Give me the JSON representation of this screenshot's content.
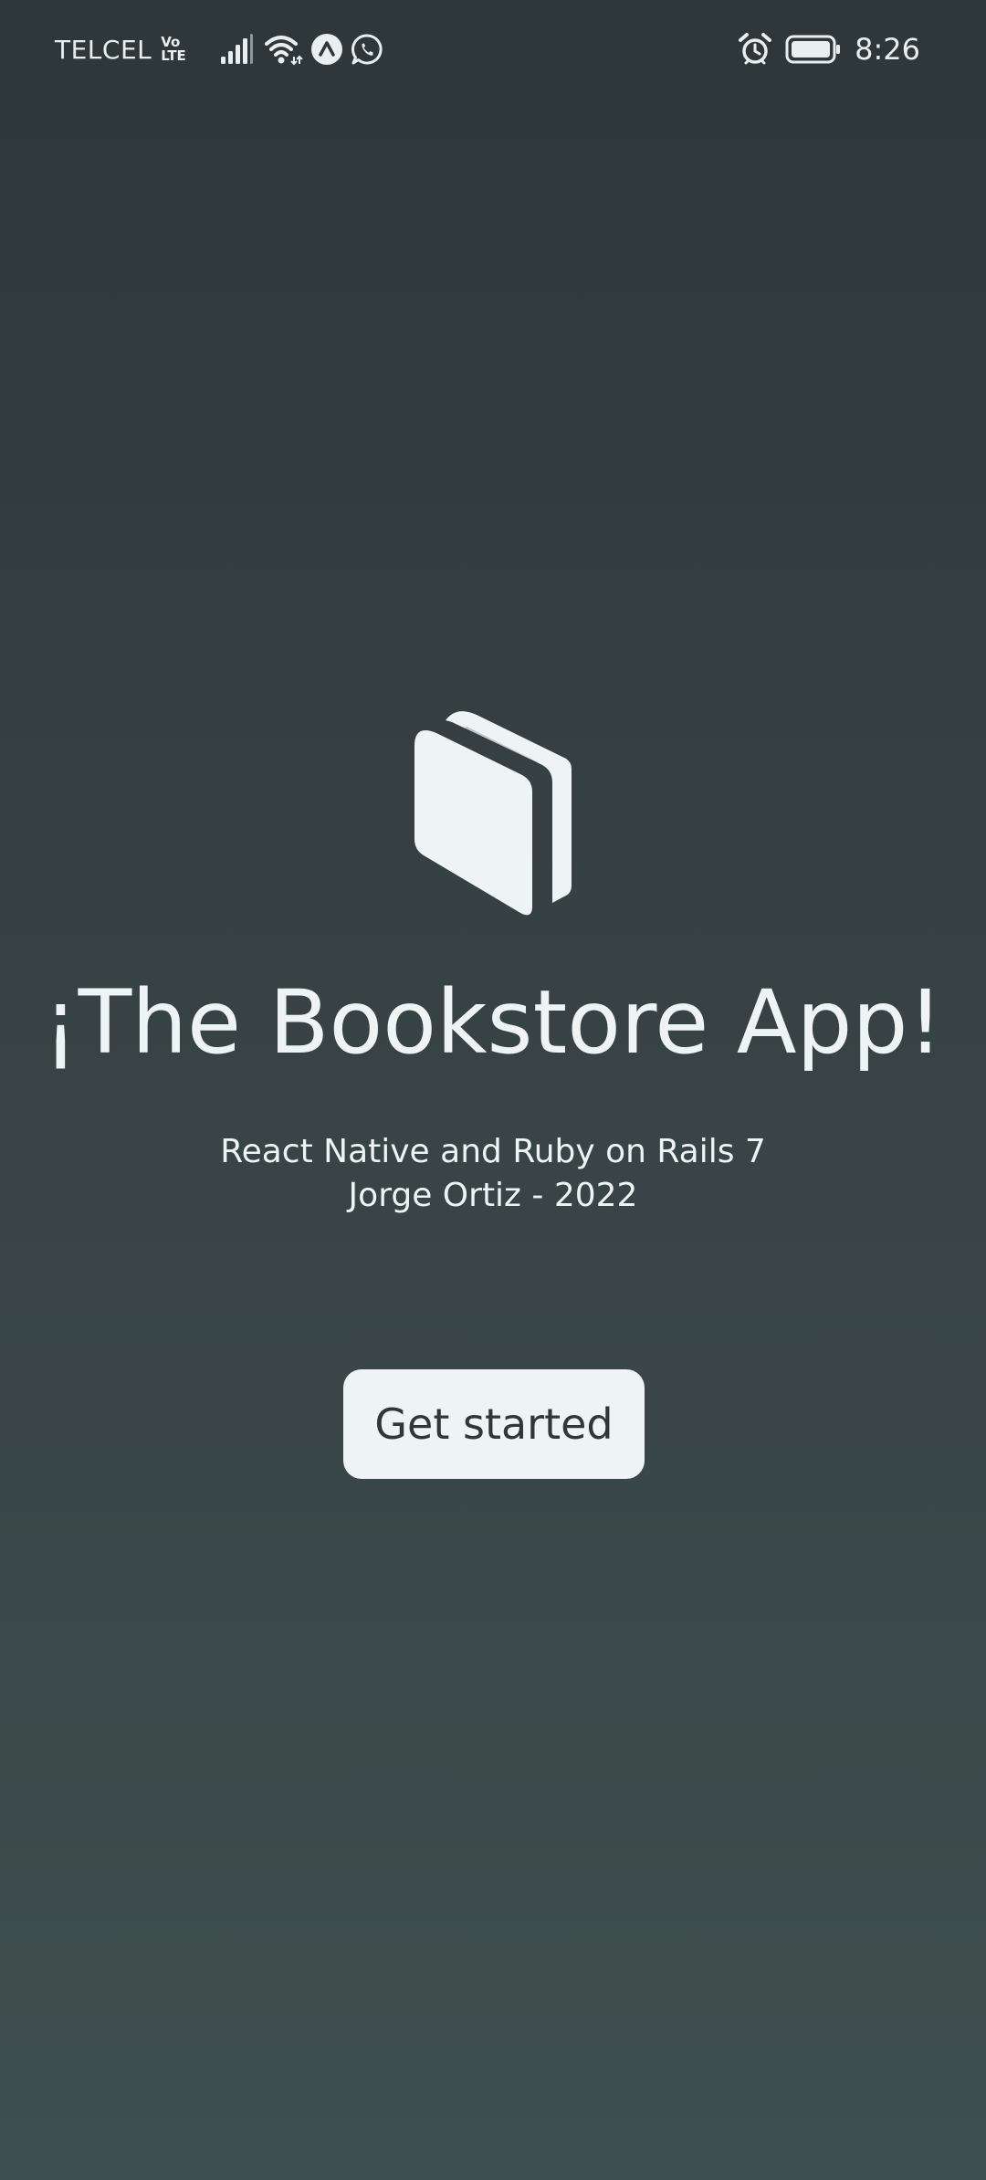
{
  "status_bar": {
    "carrier": "TELCEL",
    "volte_top": "Vo",
    "volte_bottom": "LTE",
    "time": "8:26",
    "left_icons": [
      "signal-icon",
      "wifi-icon",
      "app-notification-icon",
      "whatsapp-icon"
    ],
    "right_icons": [
      "alarm-icon",
      "battery-icon"
    ]
  },
  "main": {
    "logo_icon": "book-icon",
    "title": "¡The Bookstore App!",
    "subtitle_line1": "React Native and Ruby on Rails 7",
    "subtitle_line2": "Jorge Ortiz - 2022",
    "cta_label": "Get started"
  },
  "colors": {
    "background_top": "#2e3739",
    "background_bottom": "#3f4e4e",
    "foreground": "#eef4f4",
    "button_bg": "#eef4f4",
    "button_text": "#2f3839"
  }
}
